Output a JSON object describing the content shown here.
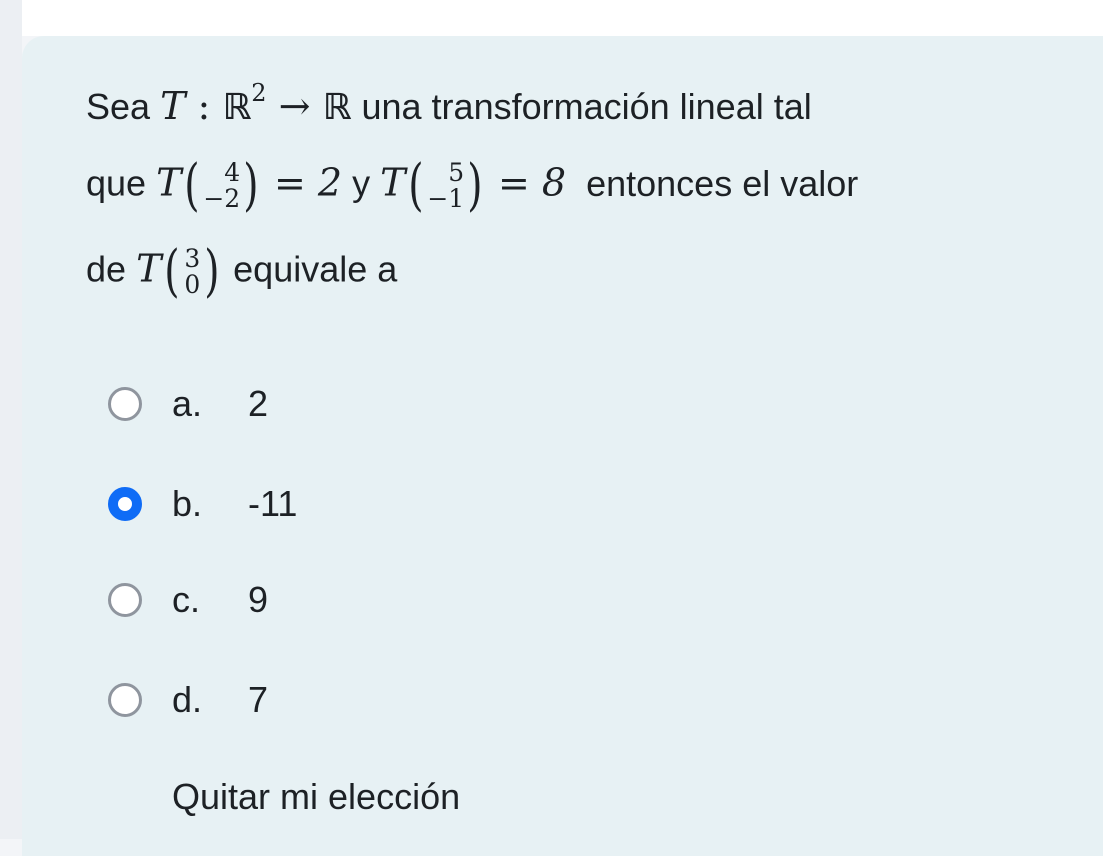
{
  "question": {
    "line1": {
      "prefix": "Sea",
      "T": "T",
      "colon": ":",
      "R": "ℝ",
      "exp": "2",
      "arrow": "→",
      "R2": "ℝ",
      "suffix": "una transformación lineal tal"
    },
    "line2": {
      "prefix": "que",
      "T1": "T",
      "v1_top": "4",
      "v1_bottom": "−2",
      "eq1": "=",
      "val1": "2",
      "conj": "y",
      "T2": "T",
      "v2_top": "5",
      "v2_bottom": "−1",
      "eq2": "=",
      "val2": "8",
      "suffix": "entonces el valor"
    },
    "line3": {
      "prefix": "de",
      "T": "T",
      "v_top": "3",
      "v_bottom": "0",
      "suffix": "equivale a"
    }
  },
  "options": [
    {
      "letter": "a.",
      "value": "2",
      "selected": false
    },
    {
      "letter": "b.",
      "value": "-11",
      "selected": true
    },
    {
      "letter": "c.",
      "value": "9",
      "selected": false
    },
    {
      "letter": "d.",
      "value": "7",
      "selected": false
    }
  ],
  "clear_choice": "Quitar mi elección",
  "colors": {
    "card_background": "#e7f1f4",
    "radio_selected": "#0f6cf6",
    "radio_unselected": "#8f959e",
    "text": "#1d2125"
  }
}
